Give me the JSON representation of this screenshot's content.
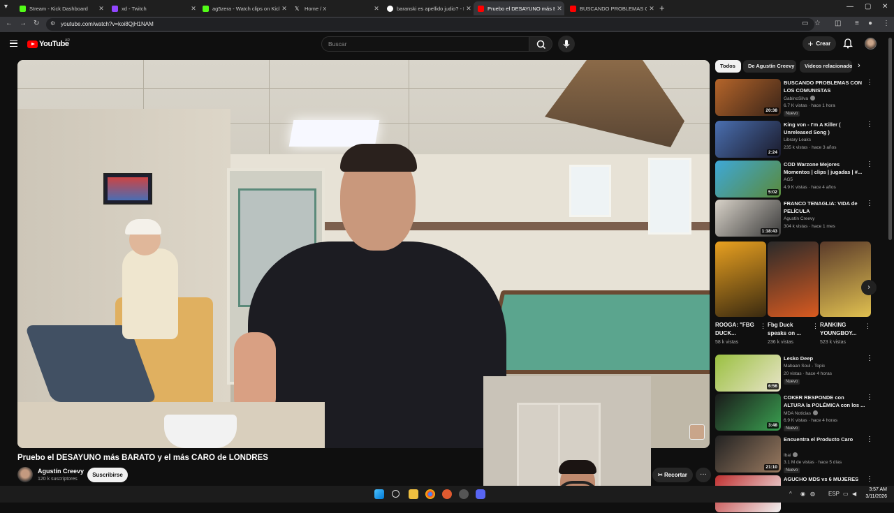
{
  "browser": {
    "tabs": [
      {
        "title": "Stream - Kick Dashboard",
        "color": "#53fc18"
      },
      {
        "title": "xd - Twitch",
        "color": "#9146ff"
      },
      {
        "title": "ag5zera - Watch clips on Kick",
        "color": "#53fc18"
      },
      {
        "title": "Home / X",
        "color": "#ffffff"
      },
      {
        "title": "baranski es apellido judio? - Bu",
        "color": "#8ab4f8"
      },
      {
        "title": "Pruebo el DESAYUNO más BAR",
        "color": "#ff0000"
      },
      {
        "title": "BUSCANDO PROBLEMAS CON",
        "color": "#ff0000"
      }
    ],
    "active_tab": 5,
    "url": "youtube.com/watch?v=koi8QjH1NAM"
  },
  "youtube": {
    "logo_text": "YouTube",
    "region": "AR",
    "search_placeholder": "Buscar",
    "create_label": "Crear"
  },
  "video": {
    "title": "Pruebo el DESAYUNO más BARATO y el más CARO de LONDRES",
    "channel": "Agustín Creevy",
    "subscribers": "120 k suscriptores",
    "subscribe_label": "Suscribirse",
    "clip_label": "Recortar",
    "more_label": "···"
  },
  "sidebar": {
    "chips": [
      "Todos",
      "De Agustín Creevy",
      "Videos relacionados"
    ],
    "recs_top": [
      {
        "title": "BUSCANDO PROBLEMAS CON LOS COMUNISTAS",
        "channel": "GabinoSilva",
        "verified": true,
        "meta": "6.7 K vistas · hace 1 hora",
        "badge": "Nuevo",
        "duration": "20:38",
        "colors": [
          "#b5652a",
          "#3a2418"
        ]
      },
      {
        "title": "King von - I'm A Killer ( Unreleased Song )",
        "channel": "Library Leaks",
        "verified": false,
        "meta": "235 k vistas · hace 3 años",
        "badge": "",
        "duration": "2:24",
        "colors": [
          "#4a6fb0",
          "#1a1a2a"
        ]
      },
      {
        "title": "COD Warzone Mejores Momentos | clips | jugadas | #...",
        "channel": "AG5",
        "verified": false,
        "meta": "4.9 K vistas · hace 4 años",
        "badge": "",
        "duration": "5:02",
        "colors": [
          "#3ea8d8",
          "#5a8a3a"
        ]
      },
      {
        "title": "FRANCO TENAGLIA: VIDA de PELÍCULA",
        "channel": "Agustín Creevy",
        "verified": false,
        "meta": "304 k vistas · hace 1 mes",
        "badge": "",
        "duration": "1:18:43",
        "colors": [
          "#d8d2c8",
          "#3a3a3a"
        ]
      }
    ],
    "shorts": [
      {
        "title": "ROOGA: \"FBG DUCK...",
        "views": "58 k vistas",
        "colors": [
          "#e8a020",
          "#3a2a10"
        ]
      },
      {
        "title": "Fbg Duck speaks on ...",
        "views": "236 k vistas",
        "colors": [
          "#2a2a2a",
          "#d85a20"
        ]
      },
      {
        "title": "RANKING YOUNGBOY...",
        "views": "523 k vistas",
        "colors": [
          "#5a3a2a",
          "#e0c050"
        ]
      }
    ],
    "recs_bottom": [
      {
        "title": "Lesko Deep",
        "channel": "Mabaan Soul - Topic",
        "verified": false,
        "meta": "20 vistas · hace 4 horas",
        "badge": "Nuevo",
        "duration": "6:56",
        "colors": [
          "#9ac040",
          "#e8e4c8"
        ]
      },
      {
        "title": "COKER RESPONDE con ALTURA la POLÉMICA con los ...",
        "channel": "MDA Noticias",
        "verified": true,
        "meta": "6.9 K vistas · hace 4 horas",
        "badge": "Nuevo",
        "duration": "3:48",
        "colors": [
          "#1a1a1a",
          "#3aa050"
        ]
      },
      {
        "title": "Encuentra el Producto Caro",
        "channel": "Ibai",
        "verified": true,
        "meta": "3.1 M de vistas · hace 5 días",
        "badge": "Nuevo",
        "duration": "21:10",
        "colors": [
          "#222222",
          "#9a7a60"
        ]
      },
      {
        "title": "AGUCHO MDS vs 6 MUJERES",
        "channel": "",
        "verified": false,
        "meta": "",
        "badge": "",
        "duration": "",
        "colors": [
          "#c03030",
          "#f0f0f0"
        ]
      }
    ]
  },
  "taskbar": {
    "lang": "ESP",
    "time": "3:57 AM",
    "date": "3/11/2026"
  },
  "colors": {
    "accent": "#ff0000",
    "background": "#0f0f0f"
  }
}
